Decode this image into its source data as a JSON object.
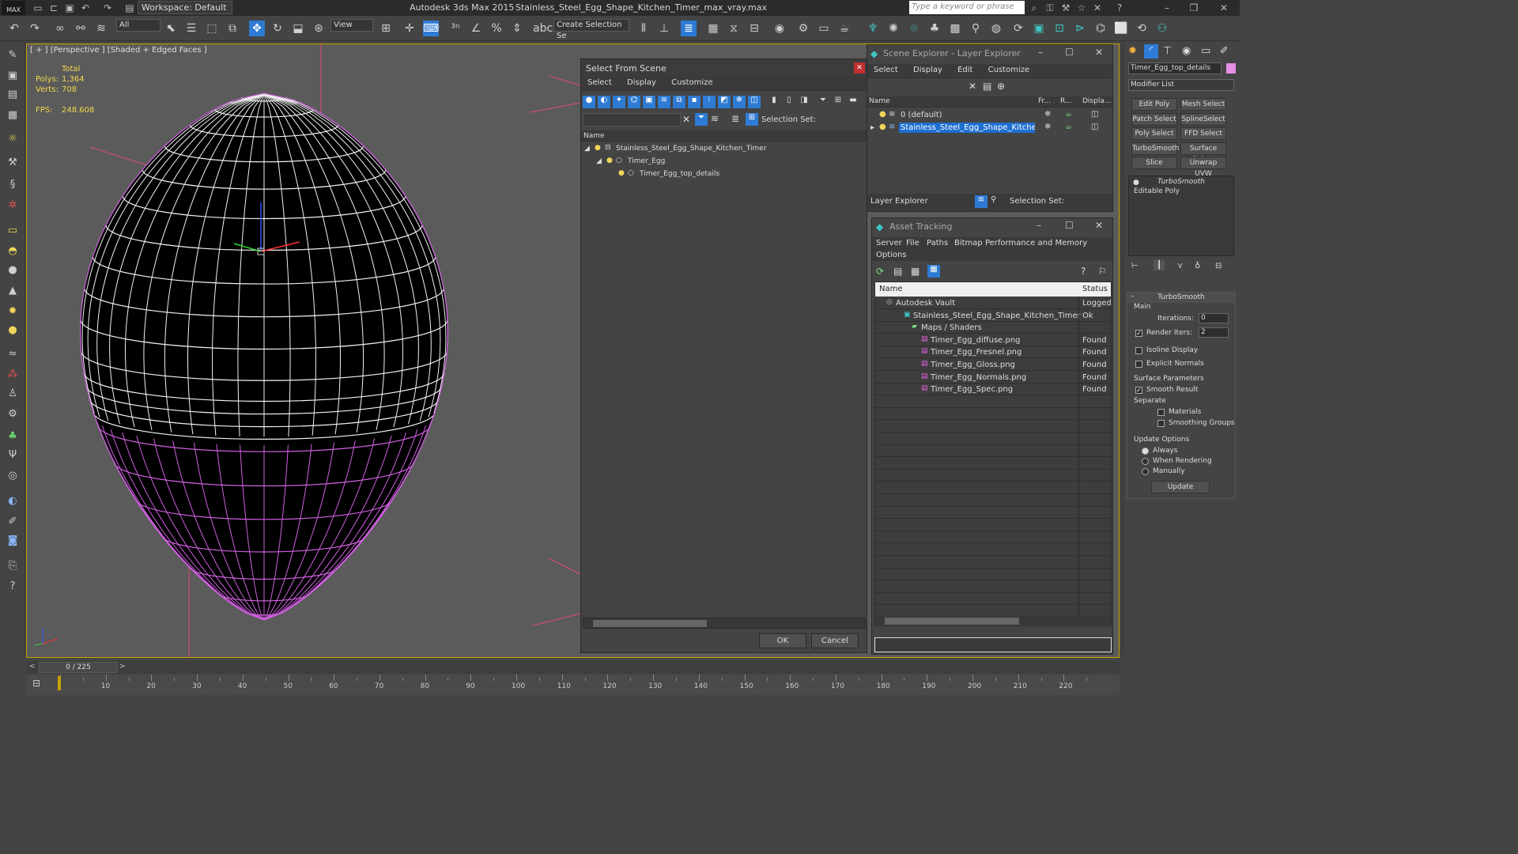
{
  "app": {
    "logo": "MAX",
    "title": "Autodesk 3ds Max  2015",
    "file": "Stainless_Steel_Egg_Shape_Kitchen_Timer_max_vray.max",
    "workspace": "Workspace: Default",
    "search_placeholder": "Type a keyword or phrase"
  },
  "toolbar": {
    "filter": "All",
    "view": "View",
    "create_selection": "Create Selection Se"
  },
  "viewport": {
    "label": "[ + ] [Perspective ] [Shaded + Edged Faces ]",
    "stats": {
      "total": "Total",
      "polys_label": "Polys:",
      "polys": "1,364",
      "verts_label": "Verts:",
      "verts": "708",
      "fps_label": "FPS:",
      "fps": "248.608"
    }
  },
  "sfs": {
    "title": "Select From Scene",
    "menu": [
      "Select",
      "Display",
      "Customize"
    ],
    "selection_set": "Selection Set:",
    "col_name": "Name",
    "tree": [
      "Stainless_Steel_Egg_Shape_Kitchen_Timer",
      "Timer_Egg",
      "Timer_Egg_top_details"
    ],
    "ok": "OK",
    "cancel": "Cancel"
  },
  "scene_explorer": {
    "title": "Scene Explorer - Layer Explorer",
    "menu": [
      "Select",
      "Display",
      "Edit",
      "Customize"
    ],
    "cols": [
      "Name",
      "Fr...",
      "R...",
      "Displa..."
    ],
    "rows": [
      "0 (default)",
      "Stainless_Steel_Egg_Shape_Kitchen_Timer"
    ],
    "footer_mode": "Layer Explorer",
    "selection_set": "Selection Set:"
  },
  "asset_tracking": {
    "title": "Asset Tracking",
    "menu": [
      "Server",
      "File",
      "Paths",
      "Bitmap Performance and Memory",
      "Options"
    ],
    "col_name": "Name",
    "col_status": "Status",
    "rows": [
      {
        "name": "Autodesk Vault",
        "status": "Logged"
      },
      {
        "name": "Stainless_Steel_Egg_Shape_Kitchen_Timer_m...",
        "status": "Ok"
      },
      {
        "name": "Maps / Shaders",
        "status": ""
      },
      {
        "name": "Timer_Egg_diffuse.png",
        "status": "Found"
      },
      {
        "name": "Timer_Egg_Fresnel.png",
        "status": "Found"
      },
      {
        "name": "Timer_Egg_Gloss.png",
        "status": "Found"
      },
      {
        "name": "Timer_Egg_Normals.png",
        "status": "Found"
      },
      {
        "name": "Timer_Egg_Spec.png",
        "status": "Found"
      }
    ]
  },
  "command_panel": {
    "object_name": "Timer_Egg_top_details",
    "modifier_list": "Modifier List",
    "buttons": [
      "Edit Poly",
      "Mesh Select",
      "Patch Select",
      "SplineSelect",
      "Poly Select",
      "FFD Select",
      "TurboSmooth",
      "Surface Select",
      "Slice",
      "Unwrap UVW"
    ],
    "stack": [
      "TurboSmooth",
      "Editable Poly"
    ],
    "rollout": "TurboSmooth",
    "main": "Main",
    "iterations_label": "Iterations:",
    "iterations": "0",
    "render_iters_label": "Render Iters:",
    "render_iters": "2",
    "isoline": "Isoline Display",
    "explicit": "Explicit Normals",
    "surface_params": "Surface Parameters",
    "smooth_result": "Smooth Result",
    "separate": "Separate",
    "materials": "Materials",
    "smoothing_groups": "Smoothing Groups",
    "update_options": "Update Options",
    "always": "Always",
    "when_rendering": "When Rendering",
    "manually": "Manually",
    "update": "Update"
  },
  "timeline": {
    "frame": "0 / 225",
    "ticks": [
      "10",
      "20",
      "30",
      "40",
      "50",
      "60",
      "70",
      "80",
      "90",
      "100",
      "110",
      "120",
      "130",
      "140",
      "150",
      "160",
      "170",
      "180",
      "190",
      "200",
      "210",
      "220"
    ]
  },
  "colors": {
    "accent": "#1c8ed6",
    "selection": "#1f6fd1",
    "viewport_border": "#c8a200",
    "stats": "#f2d84b"
  }
}
